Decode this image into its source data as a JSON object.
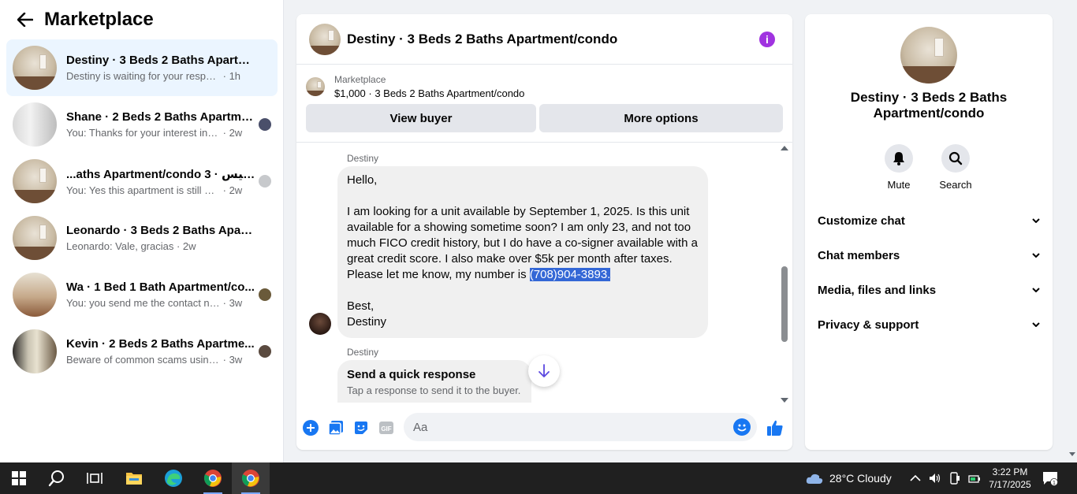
{
  "sidebar": {
    "title": "Marketplace",
    "conversations": [
      {
        "name": "Destiny · 3 Beds 2 Baths Apartmen...",
        "snippet": "Destiny is waiting for your response.",
        "time": "· 1h"
      },
      {
        "name": "Shane · 2 Beds 2 Baths Apartme...",
        "snippet": "You: Thanks for your interest in thi...",
        "time": "· 2w"
      },
      {
        "name": "...aths Apartment/condo 3 · نيفيس",
        "snippet": "You: Yes this apartment is still avail...",
        "time": "· 2w"
      },
      {
        "name": "Leonardo · 3 Beds 2 Baths Apartm...",
        "snippet": "Leonardo: Vale, gracias",
        "time": "· 2w"
      },
      {
        "name": "Wa · 1 Bed 1 Bath Apartment/co...",
        "snippet": "You: you send me the contact num...",
        "time": "· 3w"
      },
      {
        "name": "Kevin · 2 Beds 2 Baths Apartme...",
        "snippet": "Beware of common scams using p...",
        "time": "· 3w"
      }
    ]
  },
  "chat": {
    "title": "Destiny · 3 Beds 2 Baths Apartment/condo",
    "marketplace_label": "Marketplace",
    "listing": "$1,000 · 3 Beds 2 Baths Apartment/condo",
    "view_buyer": "View buyer",
    "more_options": "More options",
    "sender1": "Destiny",
    "msg_line1": "Hello,",
    "msg_body": "I am looking for a unit available by September 1, 2025. Is this unit available for a showing sometime soon? I am only 23, and not too much FICO credit history, but I do have a co-signer available with a great credit score. I also make over $5k per month after taxes. Please let me know, my number is ",
    "msg_phone": "(708)904-3893.",
    "msg_sign1": "Best,",
    "msg_sign2": "Destiny",
    "sender2": "Destiny",
    "quick_title": "Send a quick response",
    "quick_sub": "Tap a response to send it to the buyer.",
    "composer_placeholder": "Aa"
  },
  "info_panel": {
    "name": "Destiny · 3 Beds 2 Baths Apartment/condo",
    "mute": "Mute",
    "search": "Search",
    "sections": [
      "Customize chat",
      "Chat members",
      "Media, files and links",
      "Privacy & support"
    ]
  },
  "taskbar": {
    "weather": "28°C  Cloudy",
    "time": "3:22 PM",
    "date": "7/17/2025",
    "notif_count": "1"
  },
  "colors": {
    "accent": "#1877f2",
    "info": "#a033e0",
    "highlight": "#3367d6",
    "active_conv": "#ebf5ff"
  }
}
